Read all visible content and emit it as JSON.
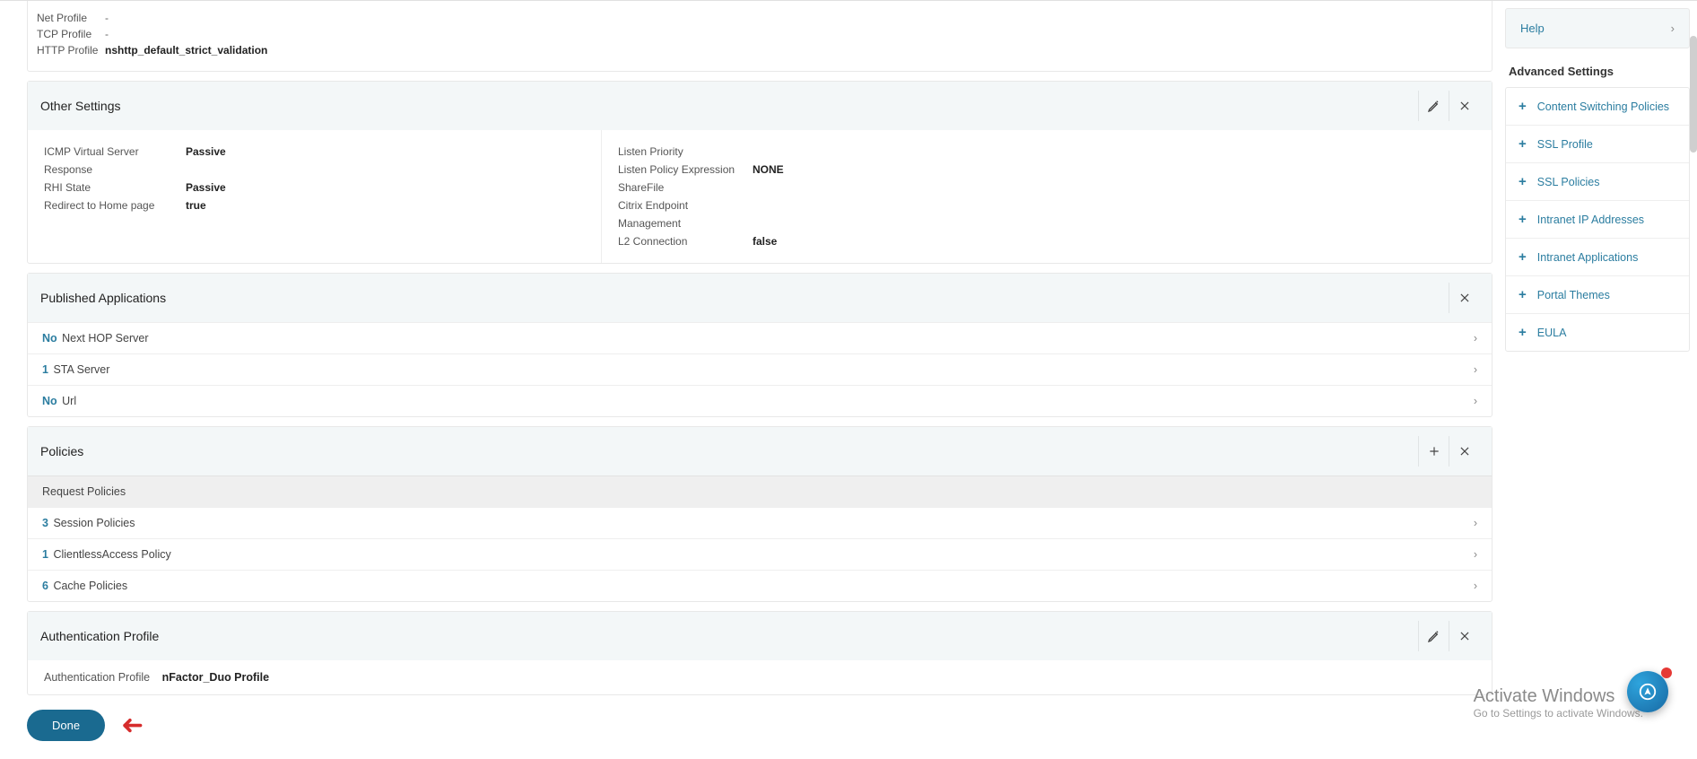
{
  "topProfiles": {
    "net": {
      "label": "Net Profile",
      "value": "-"
    },
    "tcp": {
      "label": "TCP Profile",
      "value": "-"
    },
    "http": {
      "label": "HTTP Profile",
      "value": "nshttp_default_strict_validation"
    }
  },
  "otherSettings": {
    "title": "Other Settings",
    "left": {
      "icmp": {
        "label": "ICMP Virtual Server Response",
        "value": "Passive"
      },
      "rhi": {
        "label": "RHI State",
        "value": "Passive"
      },
      "redirect": {
        "label": "Redirect to Home page",
        "value": "true"
      }
    },
    "right": {
      "listenPriority": {
        "label": "Listen Priority",
        "value": ""
      },
      "listenPolicy": {
        "label": "Listen Policy Expression",
        "value": "NONE"
      },
      "sharefile": {
        "label": "ShareFile",
        "value": ""
      },
      "cem": {
        "label": "Citrix Endpoint Management",
        "value": ""
      },
      "l2": {
        "label": "L2 Connection",
        "value": "false"
      }
    }
  },
  "publishedApps": {
    "title": "Published Applications",
    "rows": [
      {
        "count": "No",
        "text": "Next HOP Server"
      },
      {
        "count": "1",
        "text": "STA Server"
      },
      {
        "count": "No",
        "text": "Url"
      }
    ]
  },
  "policies": {
    "title": "Policies",
    "subheader": "Request Policies",
    "rows": [
      {
        "count": "3",
        "text": "Session Policies"
      },
      {
        "count": "1",
        "text": "ClientlessAccess Policy"
      },
      {
        "count": "6",
        "text": "Cache Policies"
      }
    ]
  },
  "authProfile": {
    "title": "Authentication Profile",
    "label": "Authentication Profile",
    "value": "nFactor_Duo Profile"
  },
  "done": {
    "label": "Done"
  },
  "side": {
    "help": "Help",
    "advTitle": "Advanced Settings",
    "items": [
      "Content Switching Policies",
      "SSL Profile",
      "SSL Policies",
      "Intranet IP Addresses",
      "Intranet Applications",
      "Portal Themes",
      "EULA"
    ]
  },
  "watermark": {
    "line1": "Activate Windows",
    "line2": "Go to Settings to activate Windows."
  }
}
